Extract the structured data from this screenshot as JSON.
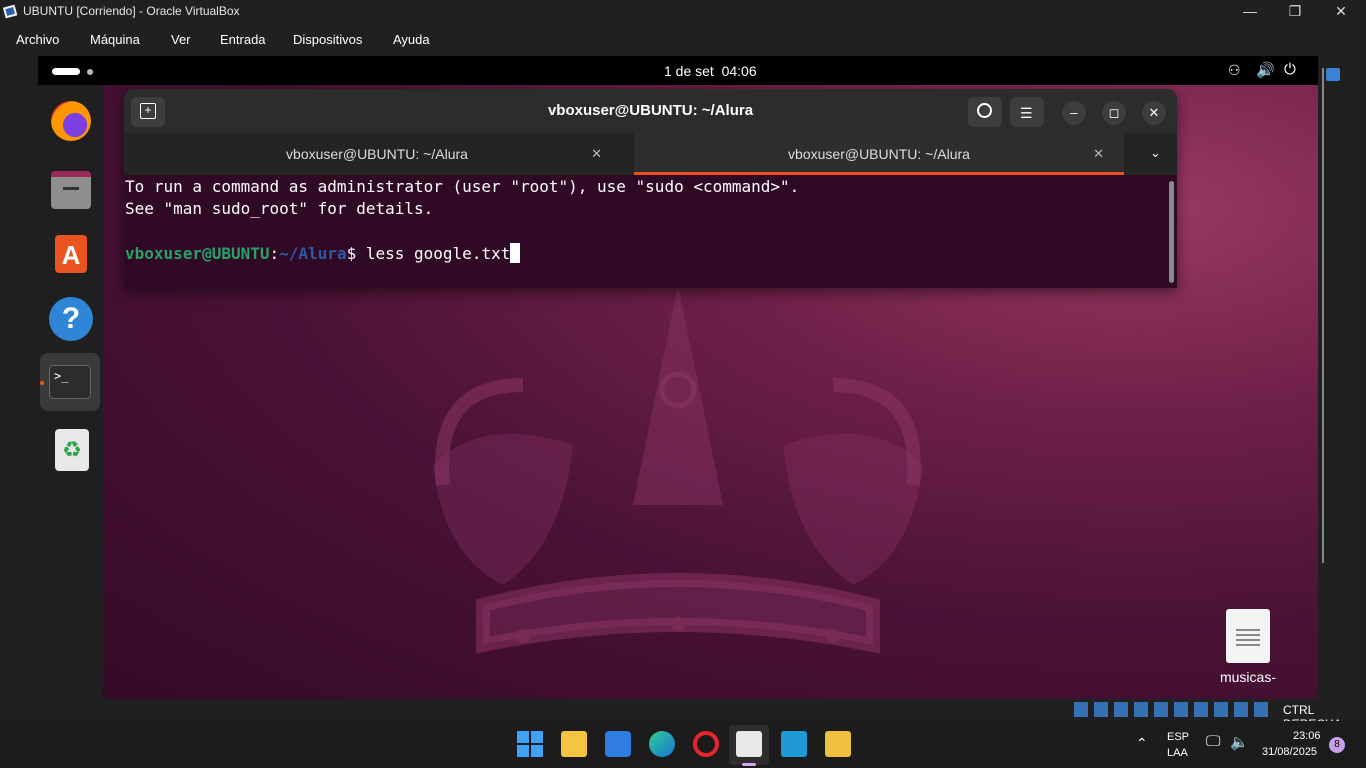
{
  "host": {
    "title": "UBUNTU [Corriendo] - Oracle VirtualBox",
    "menu": [
      "Archivo",
      "Máquina",
      "Ver",
      "Entrada",
      "Dispositivos",
      "Ayuda"
    ],
    "window_controls": {
      "minimize": "—",
      "restore": "❐",
      "close": "✕"
    }
  },
  "gnome": {
    "clock": "1 de set  04:06",
    "dock": [
      {
        "name": "firefox-icon"
      },
      {
        "name": "files-icon"
      },
      {
        "name": "app-center-icon"
      },
      {
        "name": "help-icon",
        "glyph": "?"
      },
      {
        "name": "terminal-icon",
        "glyph": ">_"
      },
      {
        "name": "trash-icon",
        "glyph": "♻"
      }
    ]
  },
  "terminal": {
    "title": "vboxuser@UBUNTU: ~/Alura",
    "tabs": [
      {
        "label": "vboxuser@UBUNTU: ~/Alura",
        "active": false
      },
      {
        "label": "vboxuser@UBUNTU: ~/Alura",
        "active": true
      }
    ],
    "output": [
      "To run a command as administrator (user \"root\"), use \"sudo <command>\".",
      "See \"man sudo_root\" for details."
    ],
    "prompt_user": "vboxuser@UBUNTU",
    "prompt_sep": ":",
    "prompt_path": "~/Alura",
    "prompt_symbol": "$",
    "command": " less google.txt",
    "colors": {
      "bg": "#300a24",
      "user": "#26a269",
      "path": "#12488b",
      "accent": "#e95420"
    }
  },
  "desktop": {
    "file_label": "musicas-favoritas.txt"
  },
  "tray": {
    "hotkey": "CTRL DERECHA",
    "lang": "ESP",
    "layout": "LAA",
    "time": "23:06",
    "date": "31/08/2025",
    "notif_count": "8"
  }
}
